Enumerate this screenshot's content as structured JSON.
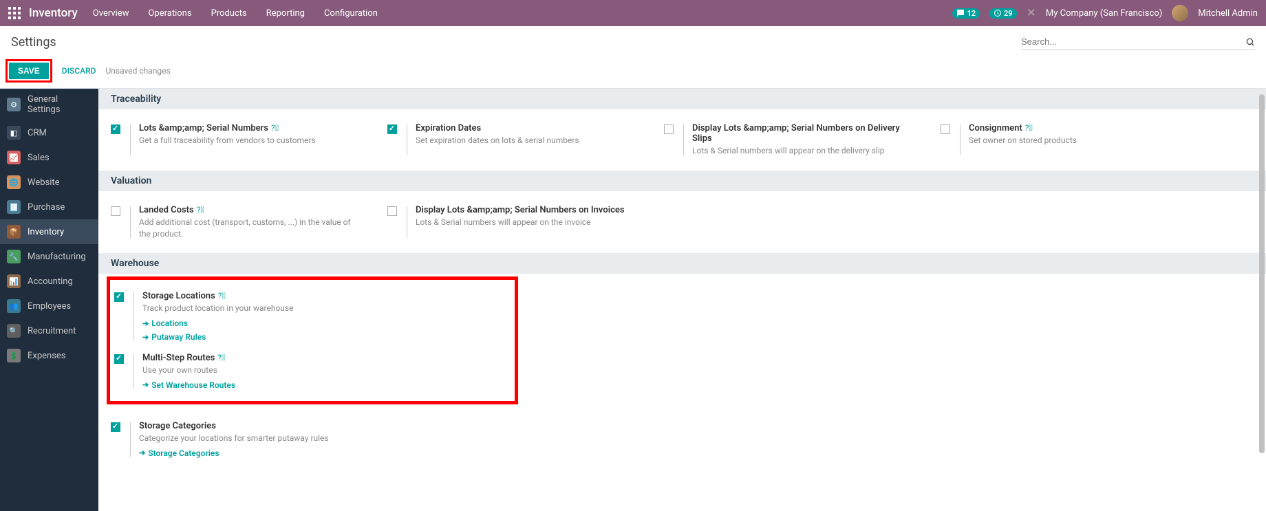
{
  "topnav": {
    "app_title": "Inventory",
    "menu": [
      "Overview",
      "Operations",
      "Products",
      "Reporting",
      "Configuration"
    ],
    "badges": {
      "messages": "12",
      "activities": "29"
    },
    "company": "My Company (San Francisco)",
    "user": "Mitchell Admin"
  },
  "header": {
    "title": "Settings",
    "search_placeholder": "Search...",
    "save": "SAVE",
    "discard": "DISCARD",
    "unsaved": "Unsaved changes"
  },
  "sidebar": {
    "items": [
      {
        "label": "General Settings",
        "icon": "ic-general"
      },
      {
        "label": "CRM",
        "icon": "ic-crm"
      },
      {
        "label": "Sales",
        "icon": "ic-sales"
      },
      {
        "label": "Website",
        "icon": "ic-website"
      },
      {
        "label": "Purchase",
        "icon": "ic-purchase"
      },
      {
        "label": "Inventory",
        "icon": "ic-inventory",
        "active": true
      },
      {
        "label": "Manufacturing",
        "icon": "ic-manufacturing"
      },
      {
        "label": "Accounting",
        "icon": "ic-accounting"
      },
      {
        "label": "Employees",
        "icon": "ic-employees"
      },
      {
        "label": "Recruitment",
        "icon": "ic-recruitment"
      },
      {
        "label": "Expenses",
        "icon": "ic-expenses"
      }
    ]
  },
  "sections": {
    "traceability": {
      "heading": "Traceability",
      "lots": {
        "title": "Lots &amp;amp; Serial Numbers",
        "desc": "Get a full traceability from vendors to customers",
        "checked": true,
        "help": true
      },
      "expiration": {
        "title": "Expiration Dates",
        "desc": "Set expiration dates on lots & serial numbers",
        "checked": true
      },
      "display_slips": {
        "title": "Display Lots &amp;amp; Serial Numbers on Delivery Slips",
        "desc": "Lots & Serial numbers will appear on the delivery slip",
        "checked": false
      },
      "consignment": {
        "title": "Consignment",
        "desc": "Set owner on stored products",
        "checked": false,
        "help": true
      }
    },
    "valuation": {
      "heading": "Valuation",
      "landed": {
        "title": "Landed Costs",
        "desc": "Add additional cost (transport, customs, ...) in the value of the product.",
        "checked": false,
        "help": true
      },
      "display_inv": {
        "title": "Display Lots &amp;amp; Serial Numbers on Invoices",
        "desc": "Lots & Serial numbers will appear on the invoice",
        "checked": false
      }
    },
    "warehouse": {
      "heading": "Warehouse",
      "storage_loc": {
        "title": "Storage Locations",
        "desc": "Track product location in your warehouse",
        "checked": true,
        "help": true,
        "links": [
          "Locations",
          "Putaway Rules"
        ]
      },
      "multistep": {
        "title": "Multi-Step Routes",
        "desc": "Use your own routes",
        "checked": true,
        "help": true,
        "links": [
          "Set Warehouse Routes"
        ]
      },
      "storage_cat": {
        "title": "Storage Categories",
        "desc": "Categorize your locations for smarter putaway rules",
        "checked": true,
        "links": [
          "Storage Categories"
        ]
      }
    }
  }
}
